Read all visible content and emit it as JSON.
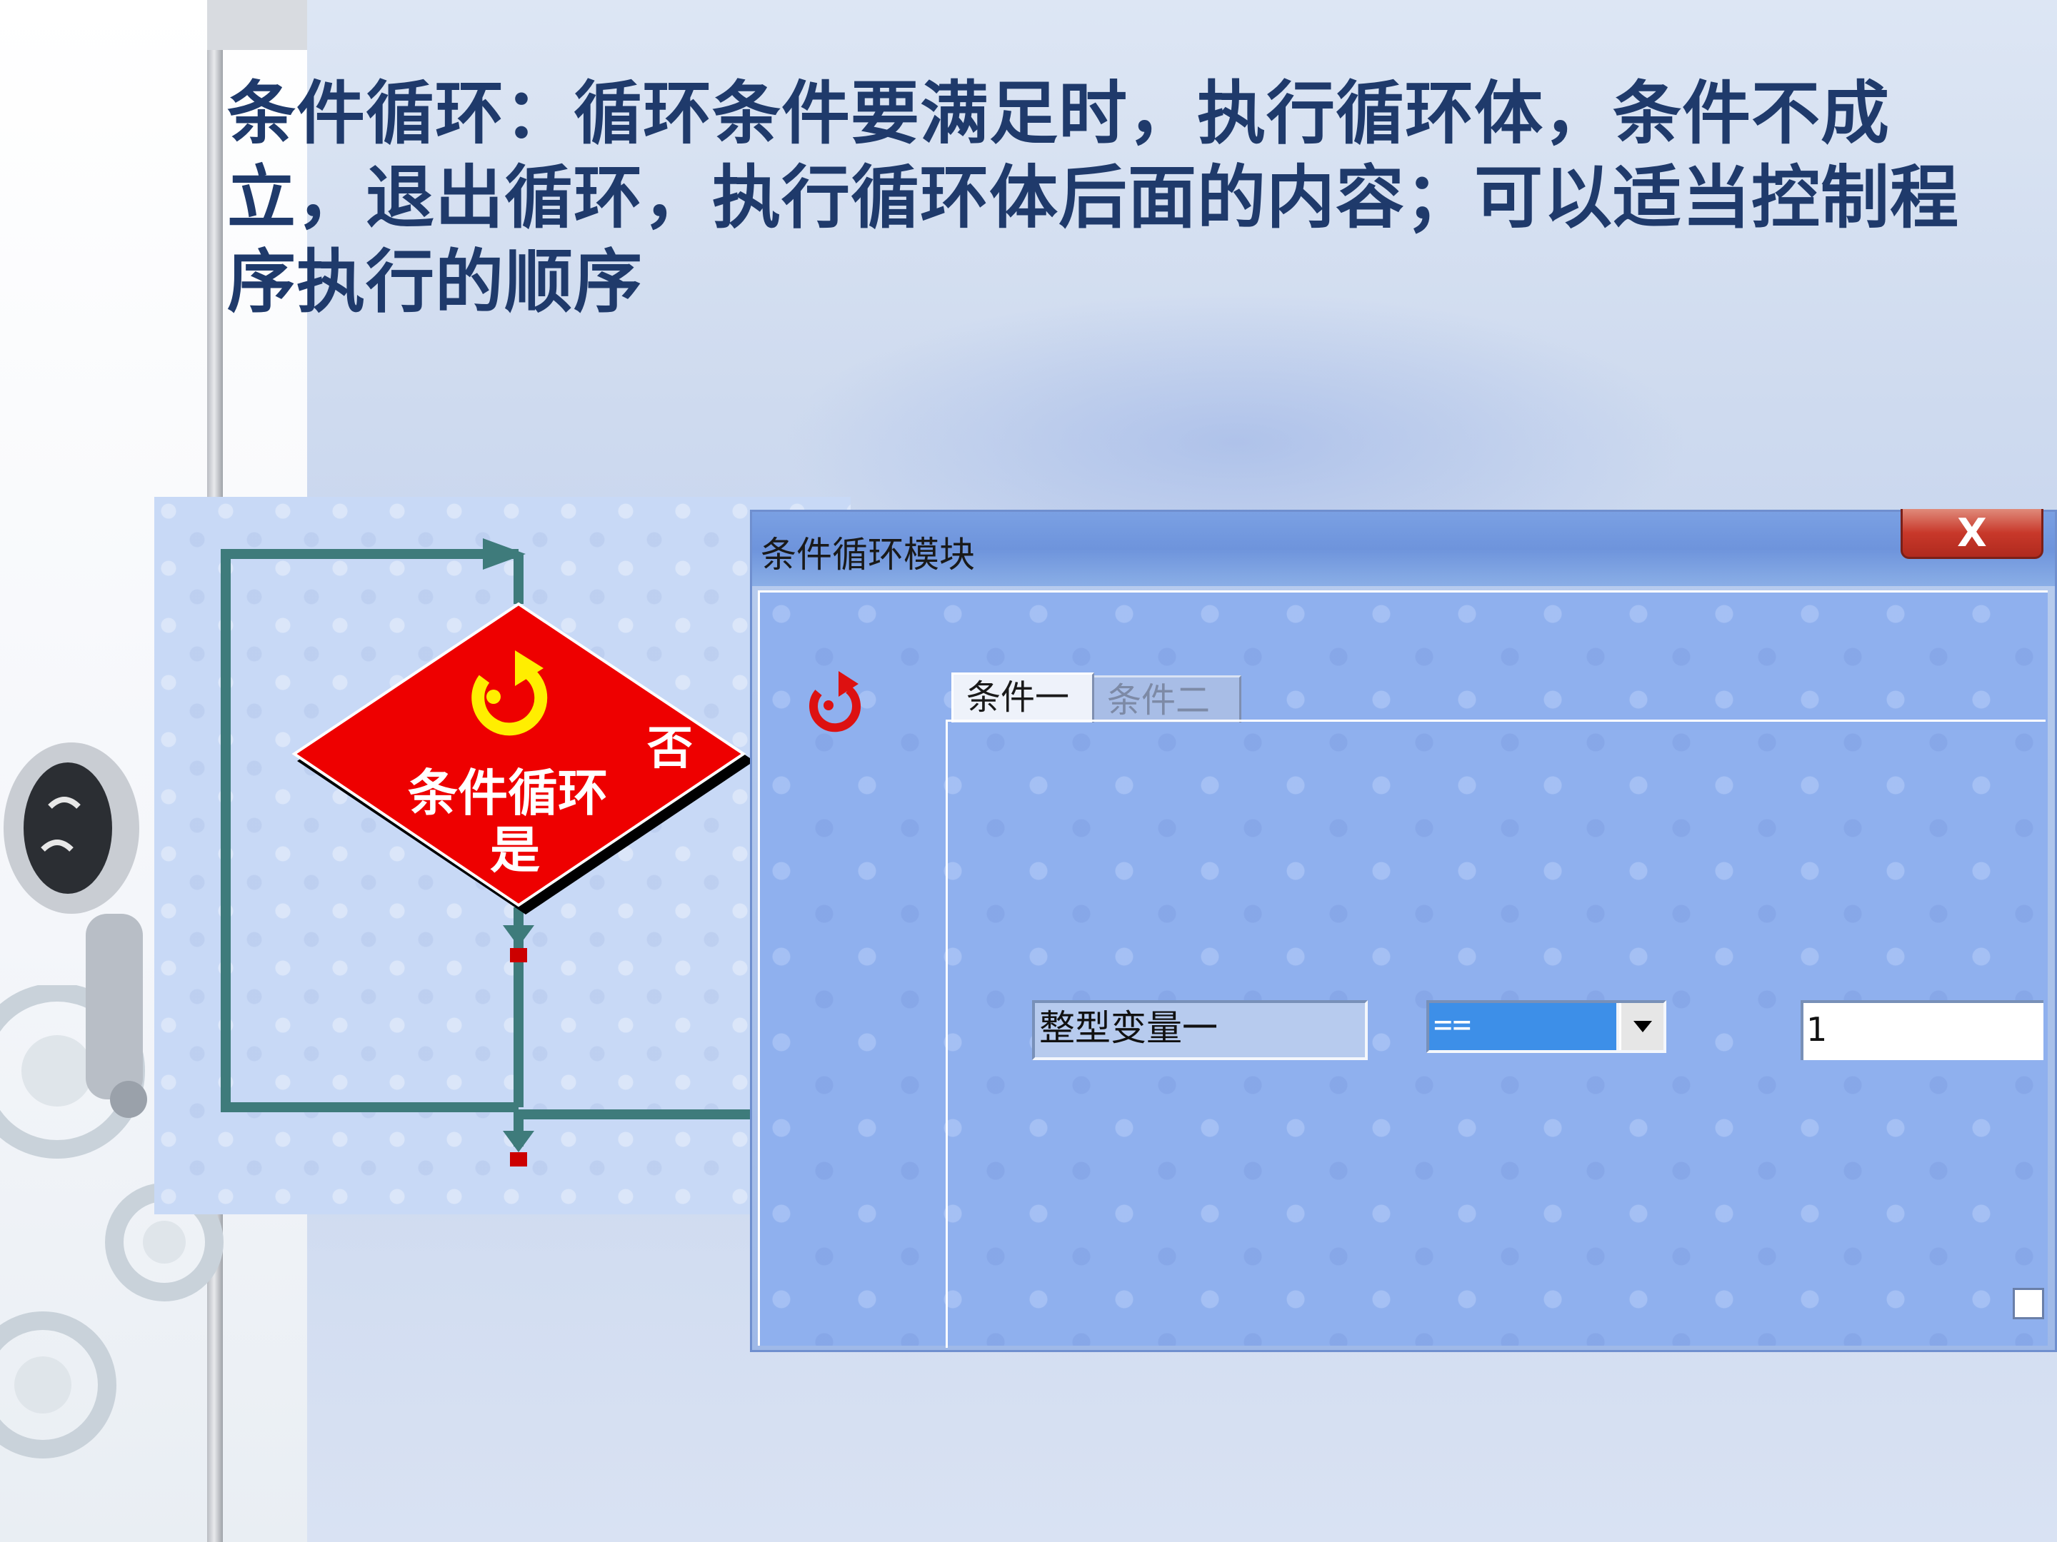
{
  "slide": {
    "title": "条件循环：循环条件要满足时，执行循环体，条件不成立，退出循环，执行循环体后面的内容；可以适当控制程序执行的顺序"
  },
  "flowchart": {
    "node_label": "条件循环",
    "yes_label": "是",
    "no_label": "否",
    "colors": {
      "diamond": "#ee0000",
      "line": "#3e7b7b",
      "arrow_marker": "#cc0000"
    }
  },
  "dialog": {
    "title": "条件循环模块",
    "close_label": "X",
    "tabs": [
      {
        "label": "条件一",
        "active": true
      },
      {
        "label": "条件二",
        "active": false
      }
    ],
    "variable_field": "整型变量一",
    "operator_select": {
      "value": "=="
    },
    "value_input": "1",
    "icons": [
      "loop-icon",
      "dropdown-arrow-icon"
    ]
  }
}
